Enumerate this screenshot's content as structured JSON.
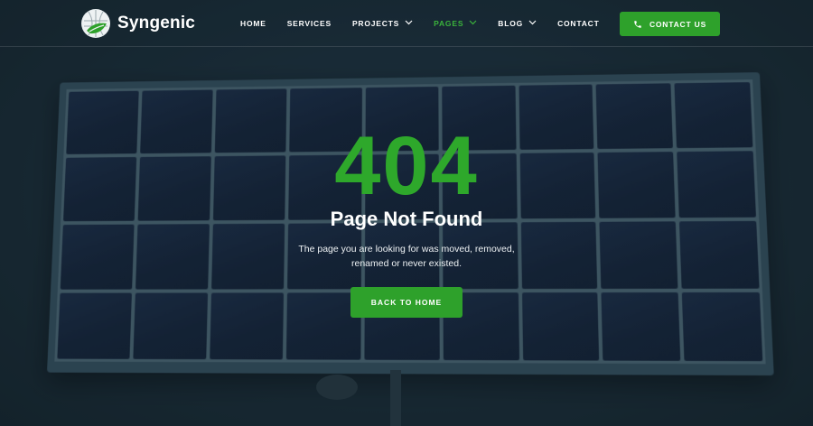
{
  "header": {
    "brand": "Syngenic",
    "nav": [
      {
        "label": "HOME",
        "has_dropdown": false,
        "active": false
      },
      {
        "label": "SERVICES",
        "has_dropdown": false,
        "active": false
      },
      {
        "label": "PROJECTS",
        "has_dropdown": true,
        "active": false
      },
      {
        "label": "PAGES",
        "has_dropdown": true,
        "active": true
      },
      {
        "label": "BLOG",
        "has_dropdown": true,
        "active": false
      },
      {
        "label": "CONTACT",
        "has_dropdown": false,
        "active": false
      }
    ],
    "cta_label": "CONTACT US"
  },
  "error": {
    "code": "404",
    "title": "Page Not Found",
    "description_line1": "The page you are looking for was moved, removed,",
    "description_line2": "renamed or never existed.",
    "button_label": "BACK TO HOME"
  },
  "colors": {
    "accent": "#2ea12b",
    "text": "#ffffff"
  },
  "icons": {
    "logo": "globe-leaf-logo",
    "cta": "phone-icon",
    "dropdown": "chevron-down-icon"
  }
}
